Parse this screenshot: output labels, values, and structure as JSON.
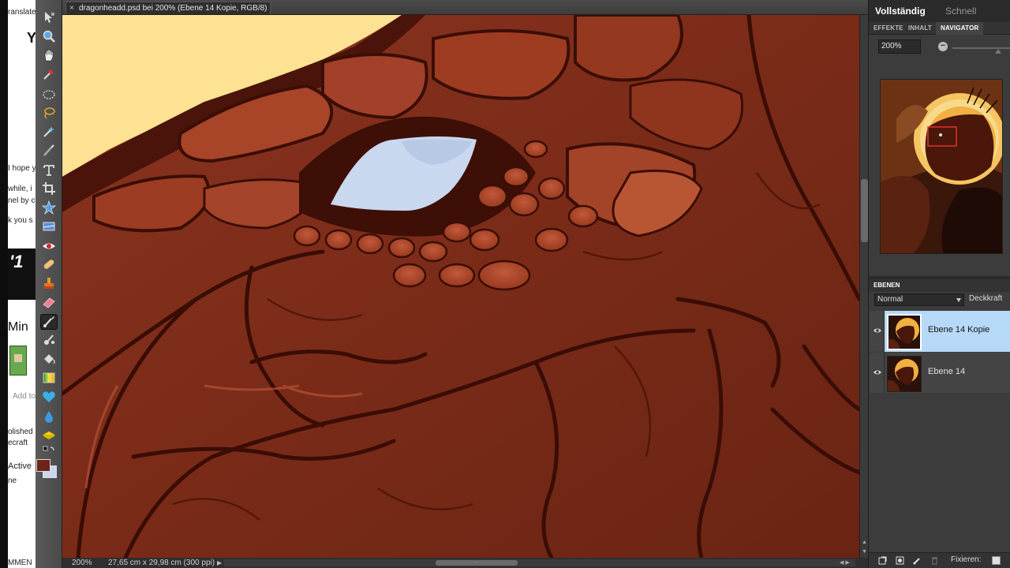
{
  "background_window": {
    "fragments": [
      "ranslate",
      "Y",
      "I hope y",
      "while, i",
      "nel by c",
      "k you s",
      "Min",
      "Add to",
      "olished",
      "ecraft",
      "Active",
      "ne",
      "MMEN"
    ],
    "banner_text": "'1"
  },
  "document": {
    "tab_title": "dragonheadd.psd bei 200% (Ebene 14 Kopie, RGB/8) *",
    "close_glyph": "×"
  },
  "status": {
    "zoom": "200%",
    "doc_size": "27,65 cm x 29,98 cm (300 ppi)"
  },
  "colors": {
    "foreground": "#6e2416",
    "background": "#c9d8ee",
    "selection": "#b7d9f8"
  },
  "mode_tabs": {
    "full": "Vollständig",
    "quick": "Schnell"
  },
  "panel_tabs": [
    "EFFEKTE",
    "INHALT",
    "NAVIGATOR"
  ],
  "navigator": {
    "zoom_value": "200%"
  },
  "layers_panel": {
    "title": "EBENEN",
    "blend_mode": "Normal",
    "opacity_label": "Deckkraft",
    "layers": [
      {
        "name": "Ebene 14 Kopie",
        "selected": true
      },
      {
        "name": "Ebene 14",
        "selected": false
      }
    ],
    "lock_label": "Fixieren:"
  },
  "tools": [
    "move-tool-icon",
    "zoom-tool-icon",
    "hand-tool-icon",
    "eyedropper-tool-icon",
    "marquee-tool-icon",
    "lasso-tool-icon",
    "magic-wand-tool-icon",
    "selection-brush-tool-icon",
    "type-tool-icon",
    "crop-tool-icon",
    "cookie-cutter-tool-icon",
    "straighten-tool-icon",
    "red-eye-tool-icon",
    "healing-brush-tool-icon",
    "clone-stamp-tool-icon",
    "eraser-tool-icon",
    "brush-tool-icon",
    "smart-brush-tool-icon",
    "paint-bucket-tool-icon",
    "gradient-tool-icon",
    "shape-tool-icon",
    "blur-tool-icon",
    "sponge-tool-icon"
  ]
}
